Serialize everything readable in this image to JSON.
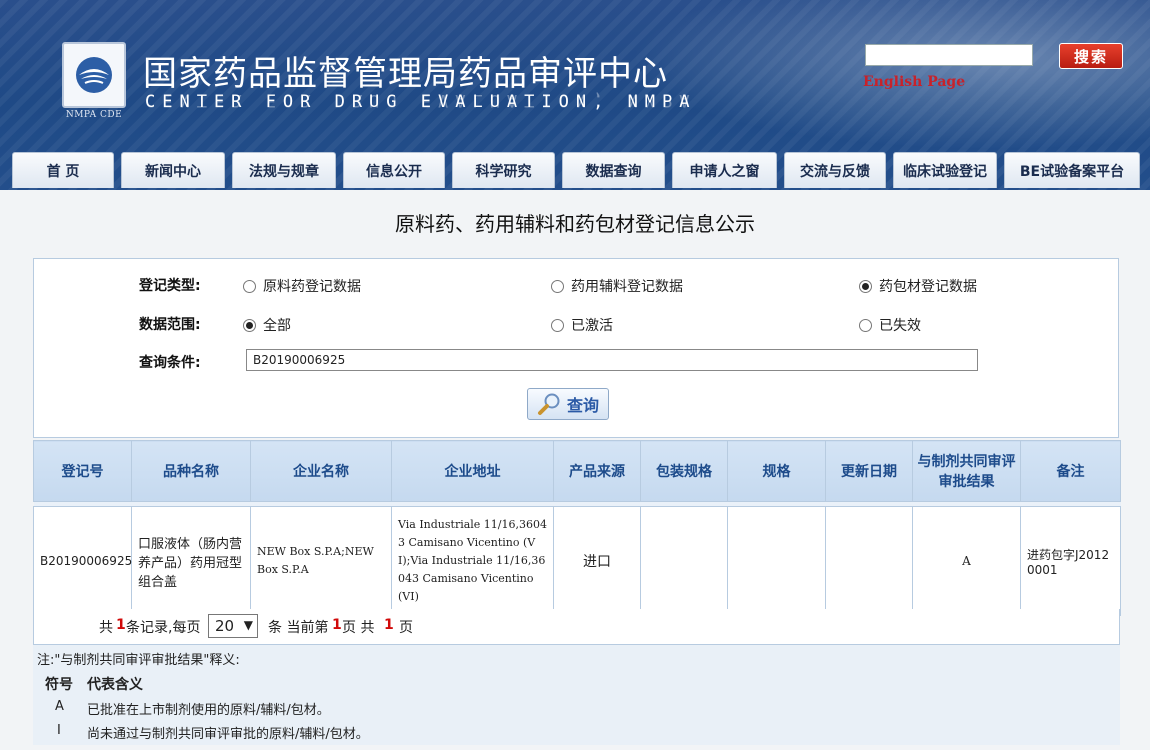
{
  "header": {
    "logo_caption": "NMPA CDE",
    "title_cn": "国家药品监督管理局药品审评中心",
    "title_en": "CENTER FOR DRUG EVALUATION, NMPA",
    "search_value": "",
    "search_button": "搜索",
    "english_link": "English Page"
  },
  "nav": {
    "tabs": [
      "首 页",
      "新闻中心",
      "法规与规章",
      "信息公开",
      "科学研究",
      "数据查询",
      "申请人之窗",
      "交流与反馈",
      "临床试验登记",
      "BE试验备案平台"
    ]
  },
  "page_title": "原料药、药用辅料和药包材登记信息公示",
  "form": {
    "type_label": "登记类型:",
    "type_options": [
      "原料药登记数据",
      "药用辅料登记数据",
      "药包材登记数据"
    ],
    "type_selected": 2,
    "range_label": "数据范围:",
    "range_options": [
      "全部",
      "已激活",
      "已失效"
    ],
    "range_selected": 0,
    "condition_label": "查询条件:",
    "condition_value": "B20190006925",
    "query_button": "查询"
  },
  "table": {
    "columns": [
      "登记号",
      "品种名称",
      "企业名称",
      "企业地址",
      "产品来源",
      "包装规格",
      "规格",
      "更新日期",
      "与制剂共同审评审批结果",
      "备注"
    ],
    "rows": [
      {
        "reg_no": "B20190006925",
        "product": "口服液体（肠内营养产品）药用冠型组合盖",
        "company": "NEW Box S.P.A;NEW Box S.P.A",
        "address": "Via Industriale 11/16,36043 Camisano Vicentino (VI);Via Industriale 11/16,36043 Camisano Vicentino (VI)",
        "source": "进口",
        "package_spec": "",
        "spec": "",
        "update_date": "",
        "review_result": "A",
        "remark": "进药包字J20120001"
      }
    ]
  },
  "pager": {
    "t1": "共",
    "total": "1",
    "t2": "条记录,每页",
    "per_page": "20",
    "t3": "条 当前第",
    "current": "1",
    "t4": "页 共",
    "pages": "1",
    "t5": "页"
  },
  "notes": {
    "intro": "注:\"与制剂共同审评审批结果\"释义:",
    "head_symbol": "符号",
    "head_meaning": "代表含义",
    "items": [
      {
        "symbol": "A",
        "meaning": "已批准在上市制剂使用的原料/辅料/包材。"
      },
      {
        "symbol": "I",
        "meaning": "尚未通过与制剂共同审评审批的原料/辅料/包材。"
      }
    ]
  }
}
